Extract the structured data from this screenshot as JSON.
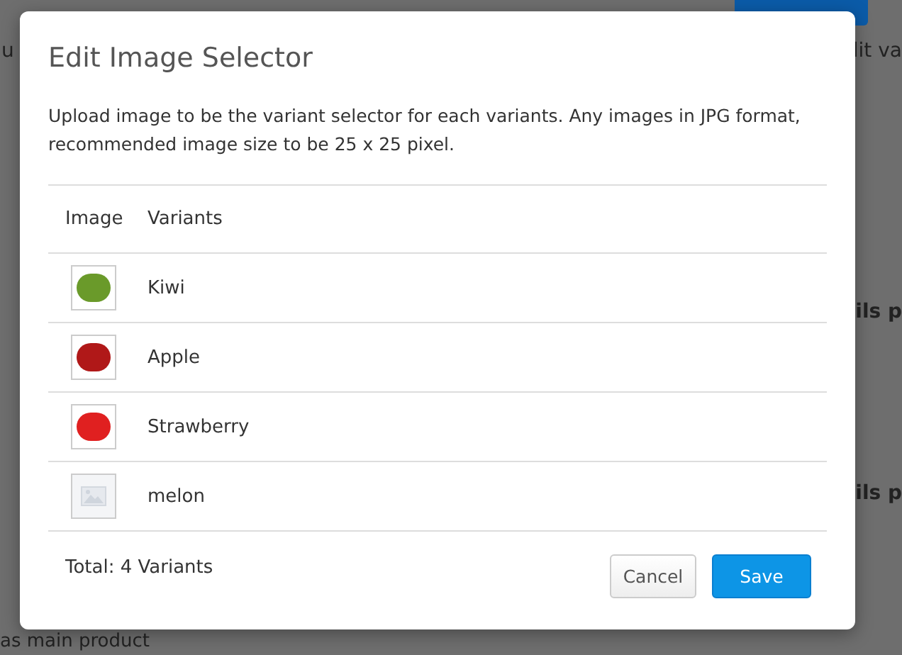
{
  "background": {
    "left_fragment": "u",
    "right_fragment": "lit va",
    "side_fragments": [
      "ils p",
      "ils p"
    ],
    "bottom_fragment": "as main product"
  },
  "dialog": {
    "title": "Edit Image Selector",
    "description": "Upload image to be the variant selector for each variants. Any images in JPG format, recommended image size to be 25 x 25 pixel.",
    "columns": [
      "Image",
      "Variants"
    ],
    "rows": [
      {
        "kind": "photo",
        "color": "#6a9a2a",
        "name": "Kiwi"
      },
      {
        "kind": "photo",
        "color": "#b01818",
        "name": "Apple"
      },
      {
        "kind": "photo",
        "color": "#e02020",
        "name": "Strawberry"
      },
      {
        "kind": "placeholder",
        "name": "melon"
      }
    ],
    "total": "Total: 4 Variants",
    "buttons": {
      "cancel": "Cancel",
      "save": "Save"
    }
  }
}
